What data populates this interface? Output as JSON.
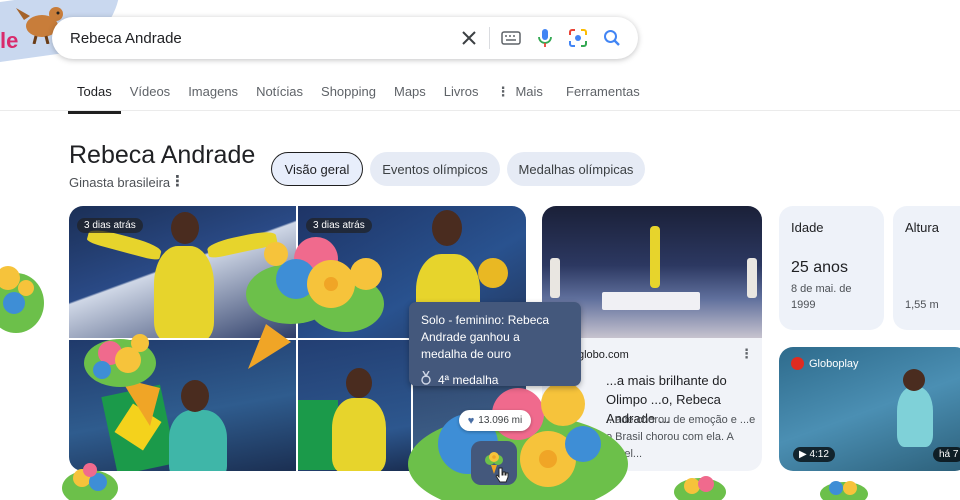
{
  "search": {
    "query": "Rebeca Andrade",
    "doodle_letters": "le"
  },
  "icons": {
    "clear": "close-icon",
    "keyboard": "keyboard-icon",
    "mic": "mic-icon",
    "lens": "lens-icon",
    "search": "search-icon"
  },
  "tabs": [
    {
      "label": "Todas",
      "active": true
    },
    {
      "label": "Vídeos"
    },
    {
      "label": "Imagens"
    },
    {
      "label": "Notícias"
    },
    {
      "label": "Shopping"
    },
    {
      "label": "Maps"
    },
    {
      "label": "Livros"
    },
    {
      "label": "Mais"
    }
  ],
  "tools_label": "Ferramentas",
  "entity": {
    "name": "Rebeca Andrade",
    "description": "Ginasta brasileira"
  },
  "chips": [
    "Visão geral",
    "Eventos olímpicos",
    "Medalhas olímpicas"
  ],
  "photos": {
    "badge_1": "3 dias atrás",
    "badge_2": "3 dias atrás"
  },
  "article": {
    "source": "globo.com",
    "title": "...a mais brilhante do Olimpo ...o, Rebeca Andrade ...",
    "snippet": "...ade chorou de emoção e ...e o Brasil chorou com ela. A estrel..."
  },
  "facts": {
    "age_label": "Idade",
    "age_value": "25 anos",
    "age_detail": "8 de mai. de 1999",
    "height_label": "Altura",
    "height_value": "1,55 m"
  },
  "video": {
    "channel": "Globoplay",
    "duration": "4:12",
    "ago": "há 7"
  },
  "tooltip": {
    "text": "Solo - feminino: Rebeca Andrade ganhou a medalha de ouro",
    "medal": "4ª medalha"
  },
  "likes": "13.096 mi",
  "colors": {
    "accent_blue": "#1a73e8",
    "tooltip_bg": "#44587c",
    "chip_bg": "#e6ebf5"
  }
}
